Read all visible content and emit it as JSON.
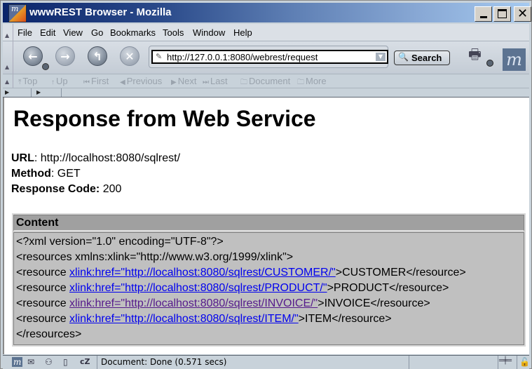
{
  "window": {
    "title": "wwwREST Browser - Mozilla",
    "minimize_label": "_",
    "close_label": "✕"
  },
  "menu": {
    "items": [
      {
        "label": "File"
      },
      {
        "label": "Edit"
      },
      {
        "label": "View"
      },
      {
        "label": "Go"
      },
      {
        "label": "Bookmarks"
      },
      {
        "label": "Tools"
      },
      {
        "label": "Window"
      },
      {
        "label": "Help"
      }
    ]
  },
  "navbar": {
    "back_icon": "←",
    "forward_icon": "→",
    "reload_icon": "↰",
    "stop_icon": "✕",
    "url": "http://127.0.0.1:8080/webrest/request",
    "url_icon": "✎",
    "url_dropdown_icon": "▼",
    "search_label": "Search",
    "search_icon": "🔍",
    "print_icon": "🖶",
    "throbber_label": "m"
  },
  "sitenav": {
    "items": [
      {
        "icon": "⤒",
        "label": "Top"
      },
      {
        "icon": "↑",
        "label": "Up"
      },
      {
        "icon": "⏮",
        "label": "First"
      },
      {
        "icon": "◀",
        "label": "Previous"
      },
      {
        "icon": "▶",
        "label": "Next"
      },
      {
        "icon": "⏭",
        "label": "Last"
      },
      {
        "icon": "🗀",
        "label": "Document"
      },
      {
        "icon": "🗀",
        "label": "More"
      }
    ]
  },
  "page": {
    "title": "Response from Web Service",
    "url_label": "URL",
    "url_value": ": http://localhost:8080/sqlrest/",
    "method_label": "Method",
    "method_value": ": GET",
    "code_label": "Response Code:",
    "code_value": " 200",
    "content_header": "Content",
    "xml": {
      "declaration": "<?xml version=\"1.0\" encoding=\"UTF-8\"?>",
      "root_open": "<resources xmlns:xlink=\"http://www.w3.org/1999/xlink\">",
      "resources": [
        {
          "prefix": "<resource ",
          "link": "xlink:href=\"http://localhost:8080/sqlrest/CUSTOMER/\"",
          "suffix": ">CUSTOMER</resource>",
          "visited": false
        },
        {
          "prefix": "<resource ",
          "link": "xlink:href=\"http://localhost:8080/sqlrest/PRODUCT/\"",
          "suffix": ">PRODUCT</resource>",
          "visited": false
        },
        {
          "prefix": "<resource ",
          "link": "xlink:href=\"http://localhost:8080/sqlrest/INVOICE/\"",
          "suffix": ">INVOICE</resource>",
          "visited": true
        },
        {
          "prefix": "<resource ",
          "link": "xlink:href=\"http://localhost:8080/sqlrest/ITEM/\"",
          "suffix": ">ITEM</resource>",
          "visited": false
        }
      ],
      "root_close": "</resources>"
    }
  },
  "status": {
    "text": "Document: Done (0.571 secs)",
    "icons": [
      "m",
      "✉",
      "⚇",
      "▯",
      "cZ"
    ],
    "online_icon": "═╪═",
    "lock_icon": "🔓"
  },
  "colors": {
    "link": "#0000ee",
    "visited_link": "#551a8b",
    "content_bg": "#c0c0c0",
    "content_header_bg": "#a0a0a0"
  }
}
